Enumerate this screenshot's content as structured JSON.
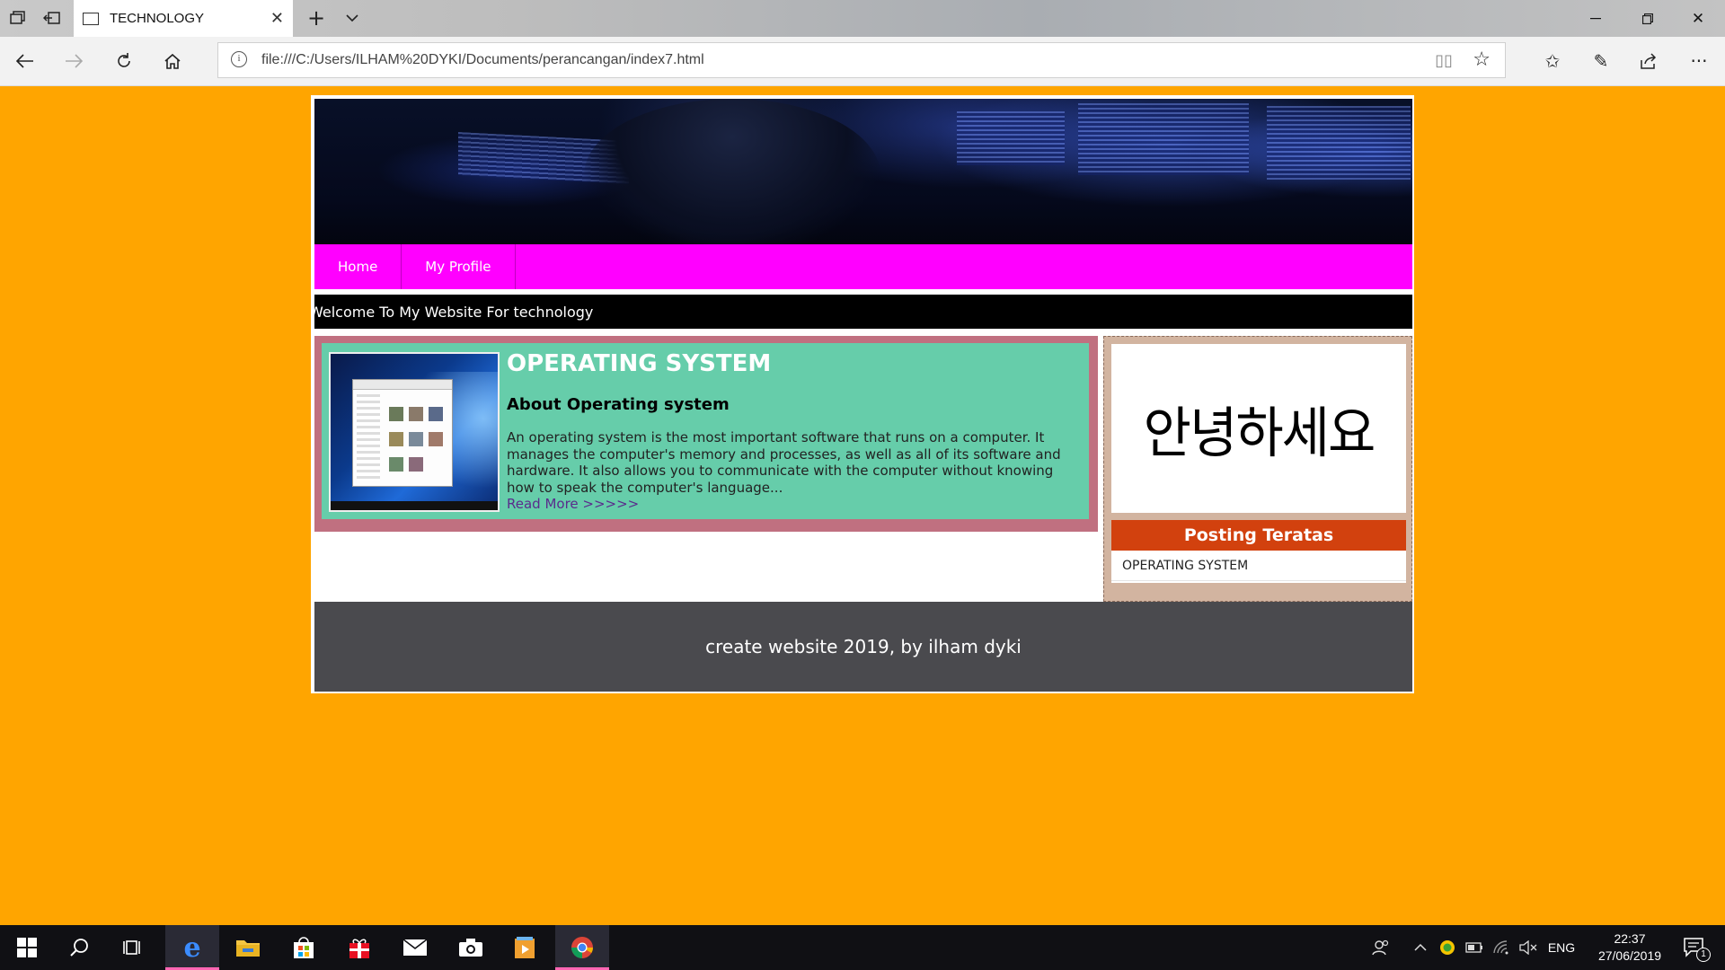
{
  "browser": {
    "tab_title": "TECHNOLOGY",
    "url": "file:///C:/Users/ILHAM%20DYKI/Documents/perancangan/index7.html"
  },
  "nav": {
    "items": [
      {
        "label": "Home"
      },
      {
        "label": "My Profile"
      }
    ]
  },
  "marquee": {
    "text": "Welcome To My Website For technology"
  },
  "article": {
    "title": "OPERATING SYSTEM",
    "subtitle": "About Operating system",
    "body": "An operating system is the most important software that runs on a computer. It manages the computer's memory and processes, as well as all of its software and hardware. It also allows you to communicate with the computer without knowing how to speak the computer's language...",
    "read_more": "Read More >>>>>"
  },
  "sidebar": {
    "greeting_image_text": "안녕하세요",
    "posting_title": "Posting Teratas",
    "posts": [
      {
        "label": "OPERATING SYSTEM"
      }
    ]
  },
  "footer": {
    "text": "create website 2019, by ilham dyki"
  },
  "taskbar": {
    "language": "ENG",
    "time": "22:37",
    "date": "27/06/2019",
    "notifications": "1"
  },
  "colors": {
    "page_background": "#FFA500",
    "nav_background": "#FF00FF",
    "article_frame": "#C07080",
    "article_background": "#66CDAA",
    "posting_header": "#D2410E",
    "footer_background": "#4A4A4E"
  }
}
